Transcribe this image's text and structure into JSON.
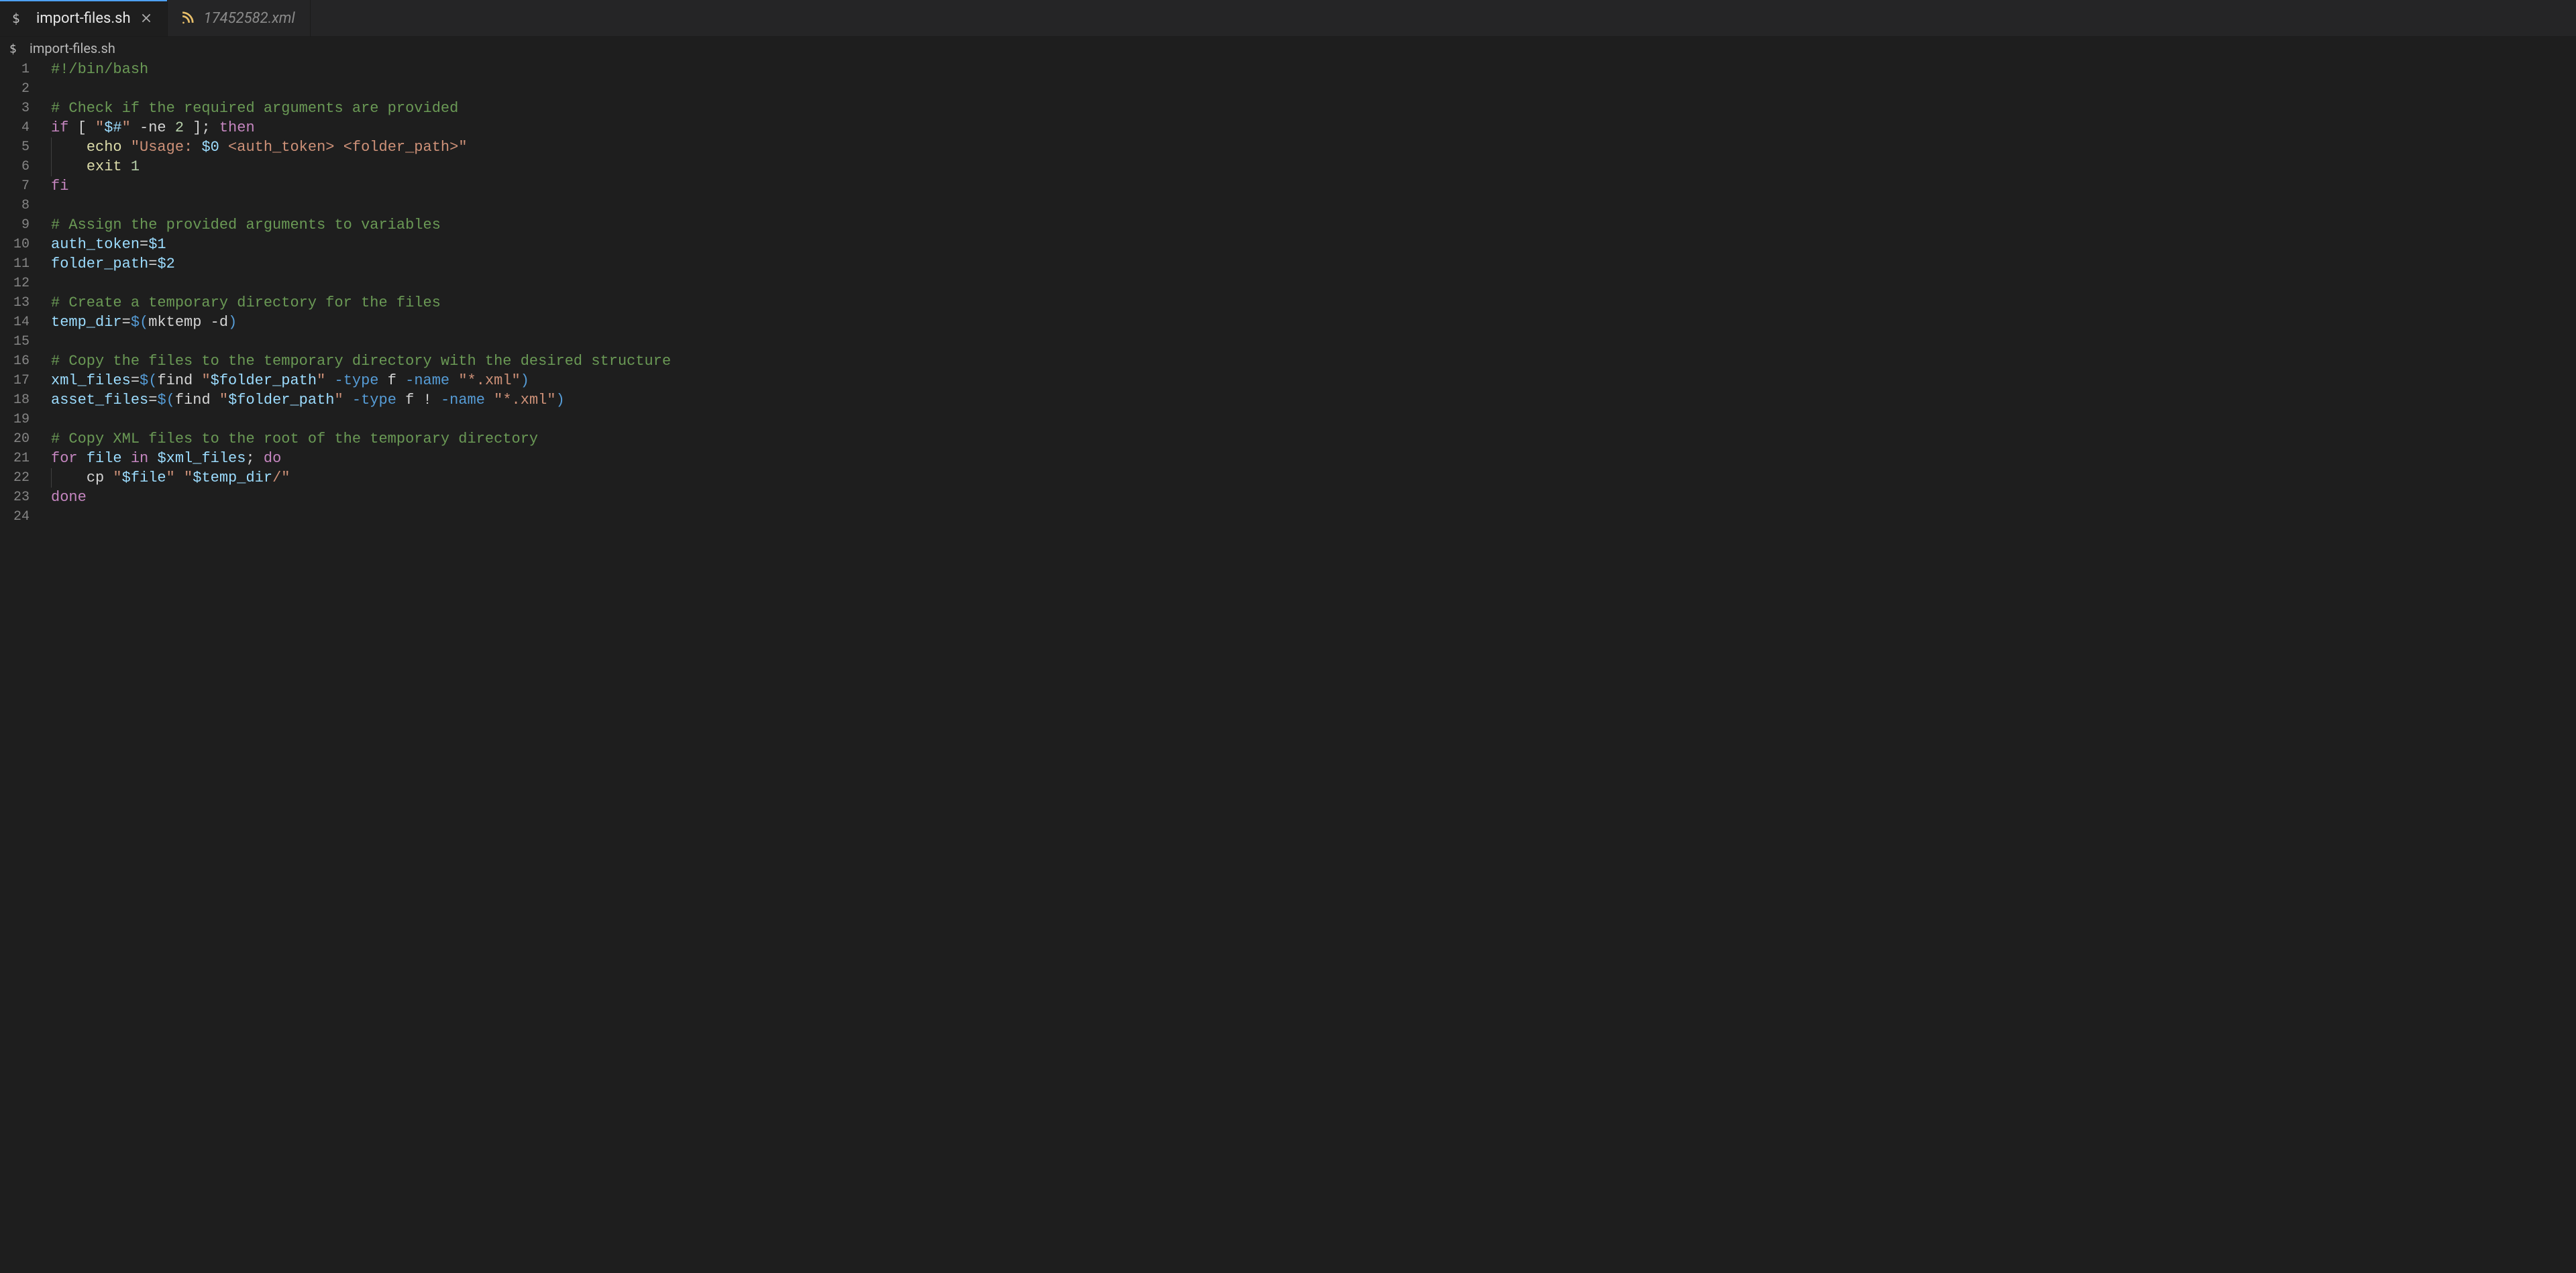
{
  "tabs": [
    {
      "label": "import-files.sh",
      "active": true,
      "italic": false,
      "iconColor": "#c5c5c5",
      "closable": true,
      "kind": "shell"
    },
    {
      "label": "17452582.xml",
      "active": false,
      "italic": true,
      "iconColor": "#e8bf6a",
      "closable": false,
      "kind": "xml"
    }
  ],
  "breadcrumb": {
    "icon": "$",
    "label": "import-files.sh"
  },
  "code": {
    "lines": [
      [
        {
          "cls": "tok-comment",
          "t": "#!/bin/bash"
        }
      ],
      [],
      [
        {
          "cls": "tok-comment",
          "t": "# Check if the required arguments are provided"
        }
      ],
      [
        {
          "cls": "tok-keyword2",
          "t": "if"
        },
        {
          "cls": "tok-default",
          "t": " [ "
        },
        {
          "cls": "tok-string",
          "t": "\""
        },
        {
          "cls": "tok-var",
          "t": "$#"
        },
        {
          "cls": "tok-string",
          "t": "\""
        },
        {
          "cls": "tok-default",
          "t": " -ne "
        },
        {
          "cls": "tok-num",
          "t": "2"
        },
        {
          "cls": "tok-default",
          "t": " ]; "
        },
        {
          "cls": "tok-keyword2",
          "t": "then"
        }
      ],
      [
        {
          "indent": 1
        },
        {
          "cls": "tok-func",
          "t": "echo"
        },
        {
          "cls": "tok-default",
          "t": " "
        },
        {
          "cls": "tok-string",
          "t": "\"Usage: "
        },
        {
          "cls": "tok-var",
          "t": "$0"
        },
        {
          "cls": "tok-string",
          "t": " <auth_token> <folder_path>\""
        }
      ],
      [
        {
          "indent": 1
        },
        {
          "cls": "tok-func",
          "t": "exit"
        },
        {
          "cls": "tok-default",
          "t": " "
        },
        {
          "cls": "tok-num",
          "t": "1"
        }
      ],
      [
        {
          "cls": "tok-keyword2",
          "t": "fi"
        }
      ],
      [],
      [
        {
          "cls": "tok-comment",
          "t": "# Assign the provided arguments to variables"
        }
      ],
      [
        {
          "cls": "tok-var",
          "t": "auth_token"
        },
        {
          "cls": "tok-default",
          "t": "="
        },
        {
          "cls": "tok-var",
          "t": "$1"
        }
      ],
      [
        {
          "cls": "tok-var",
          "t": "folder_path"
        },
        {
          "cls": "tok-default",
          "t": "="
        },
        {
          "cls": "tok-var",
          "t": "$2"
        }
      ],
      [],
      [
        {
          "cls": "tok-comment",
          "t": "# Create a temporary directory for the files"
        }
      ],
      [
        {
          "cls": "tok-var",
          "t": "temp_dir"
        },
        {
          "cls": "tok-default",
          "t": "="
        },
        {
          "cls": "tok-keyword",
          "t": "$("
        },
        {
          "cls": "tok-default",
          "t": "mktemp -d"
        },
        {
          "cls": "tok-keyword",
          "t": ")"
        }
      ],
      [],
      [
        {
          "cls": "tok-comment",
          "t": "# Copy the files to the temporary directory with the desired structure"
        }
      ],
      [
        {
          "cls": "tok-var",
          "t": "xml_files"
        },
        {
          "cls": "tok-default",
          "t": "="
        },
        {
          "cls": "tok-keyword",
          "t": "$("
        },
        {
          "cls": "tok-default",
          "t": "find "
        },
        {
          "cls": "tok-string",
          "t": "\""
        },
        {
          "cls": "tok-var",
          "t": "$folder_path"
        },
        {
          "cls": "tok-string",
          "t": "\""
        },
        {
          "cls": "tok-default",
          "t": " "
        },
        {
          "cls": "tok-flag",
          "t": "-type"
        },
        {
          "cls": "tok-default",
          "t": " f "
        },
        {
          "cls": "tok-flag",
          "t": "-name"
        },
        {
          "cls": "tok-default",
          "t": " "
        },
        {
          "cls": "tok-string",
          "t": "\"*.xml\""
        },
        {
          "cls": "tok-keyword",
          "t": ")"
        }
      ],
      [
        {
          "cls": "tok-var",
          "t": "asset_files"
        },
        {
          "cls": "tok-default",
          "t": "="
        },
        {
          "cls": "tok-keyword",
          "t": "$("
        },
        {
          "cls": "tok-default",
          "t": "find "
        },
        {
          "cls": "tok-string",
          "t": "\""
        },
        {
          "cls": "tok-var",
          "t": "$folder_path"
        },
        {
          "cls": "tok-string",
          "t": "\""
        },
        {
          "cls": "tok-default",
          "t": " "
        },
        {
          "cls": "tok-flag",
          "t": "-type"
        },
        {
          "cls": "tok-default",
          "t": " f ! "
        },
        {
          "cls": "tok-flag",
          "t": "-name"
        },
        {
          "cls": "tok-default",
          "t": " "
        },
        {
          "cls": "tok-string",
          "t": "\"*.xml\""
        },
        {
          "cls": "tok-keyword",
          "t": ")"
        }
      ],
      [],
      [
        {
          "cls": "tok-comment",
          "t": "# Copy XML files to the root of the temporary directory"
        }
      ],
      [
        {
          "cls": "tok-keyword2",
          "t": "for"
        },
        {
          "cls": "tok-default",
          "t": " "
        },
        {
          "cls": "tok-var",
          "t": "file"
        },
        {
          "cls": "tok-default",
          "t": " "
        },
        {
          "cls": "tok-keyword2",
          "t": "in"
        },
        {
          "cls": "tok-default",
          "t": " "
        },
        {
          "cls": "tok-var",
          "t": "$xml_files"
        },
        {
          "cls": "tok-default",
          "t": "; "
        },
        {
          "cls": "tok-keyword2",
          "t": "do"
        }
      ],
      [
        {
          "indent": 1
        },
        {
          "cls": "tok-default",
          "t": "cp "
        },
        {
          "cls": "tok-string",
          "t": "\""
        },
        {
          "cls": "tok-var",
          "t": "$file"
        },
        {
          "cls": "tok-string",
          "t": "\""
        },
        {
          "cls": "tok-default",
          "t": " "
        },
        {
          "cls": "tok-string",
          "t": "\""
        },
        {
          "cls": "tok-var",
          "t": "$temp_dir"
        },
        {
          "cls": "tok-string",
          "t": "/\""
        }
      ],
      [
        {
          "cls": "tok-keyword2",
          "t": "done"
        }
      ],
      []
    ]
  }
}
